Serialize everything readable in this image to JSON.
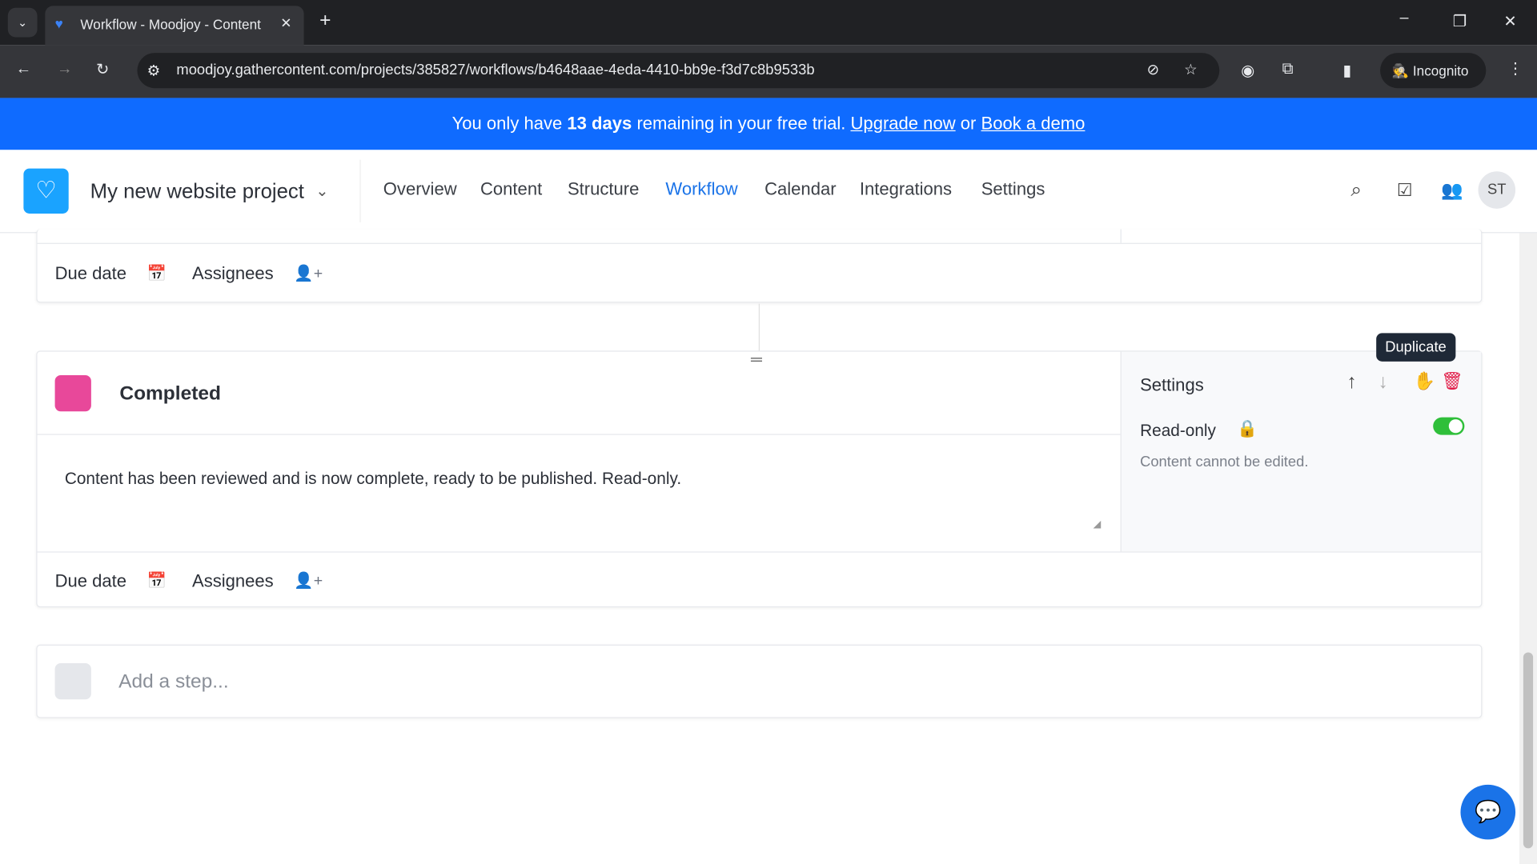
{
  "browser": {
    "tab_title": "Workflow - Moodjoy - Content",
    "url": "moodjoy.gathercontent.com/projects/385827/workflows/b4648aae-4eda-4410-bb9e-f3d7c8b9533b",
    "incognito_label": "Incognito"
  },
  "banner": {
    "prefix": "You only have",
    "days": "13 days",
    "middle": "remaining in your free trial.",
    "upgrade": "Upgrade now",
    "or": "or",
    "demo": "Book a demo"
  },
  "header": {
    "project": "My new website project",
    "nav": [
      "Overview",
      "Content",
      "Structure",
      "Workflow",
      "Calendar",
      "Integrations",
      "Settings"
    ],
    "active": "Workflow",
    "avatar": "ST"
  },
  "steps": {
    "prev": {
      "due_date": "Due date",
      "assignees": "Assignees"
    },
    "completed": {
      "name": "Completed",
      "color": "#e8489a",
      "description": "Content has been reviewed and is now complete, ready to be published. Read-only.",
      "due_date": "Due date",
      "assignees": "Assignees",
      "settings": {
        "title": "Settings",
        "readonly_label": "Read-only",
        "readonly_on": true,
        "readonly_help": "Content cannot be edited.",
        "tooltip": "Duplicate"
      }
    },
    "add_placeholder": "Add a step..."
  },
  "colors": {
    "accent": "#0f6bff",
    "toggle": "#2fbf3a",
    "delete": "#e11d48"
  }
}
